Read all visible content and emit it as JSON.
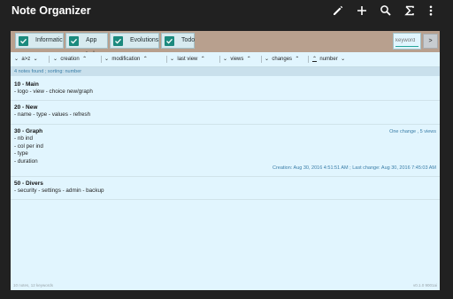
{
  "app": {
    "title": "Note Organizer"
  },
  "filters": [
    {
      "label": "Informatic",
      "checked": true
    },
    {
      "label": "App Ind",
      "checked": true
    },
    {
      "label": "Evolutions",
      "checked": true
    },
    {
      "label": "Todo",
      "checked": true
    }
  ],
  "search": {
    "placeholder": "keyword",
    "go_label": ">"
  },
  "sort": {
    "az": "a>z",
    "creation": "creation",
    "modification": "modification",
    "last_view": "last view",
    "views": "views",
    "changes": "changes",
    "number": "number",
    "asc_arrow": "⌃",
    "desc_arrow": "⌄"
  },
  "status": "4 notes found ; sorting: number",
  "notes": [
    {
      "title": "10 - Main",
      "lines": [
        "- logo  - view  - choice new/graph"
      ]
    },
    {
      "title": "20 - New",
      "lines": [
        "- name  - type  - values  - refresh"
      ]
    },
    {
      "title": "30 - Graph",
      "lines": [
        "- nb ind",
        "- col per ind",
        "- type",
        "- duration"
      ],
      "meta_top": "One change , 5 views",
      "meta_bottom": "Creation: Aug 30, 2016 4:51:51 AM ; Last change: Aug 30, 2016 7:45:03 AM"
    },
    {
      "title": "50 - Divers",
      "lines": [
        "- security  - settings  - admin  - backup"
      ]
    }
  ],
  "footer": {
    "left": "10 notes, 12 keywords",
    "right": "v0.1.0 9001ai"
  },
  "colors": {
    "accent": "#1b8a7e",
    "filterbar": "#b8a08e",
    "background": "#e1f5fe",
    "appbar": "#212121",
    "meta": "#3a7ea8"
  },
  "icons": [
    "edit-icon",
    "add-icon",
    "search-icon",
    "sigma-icon",
    "more-vert-icon"
  ]
}
